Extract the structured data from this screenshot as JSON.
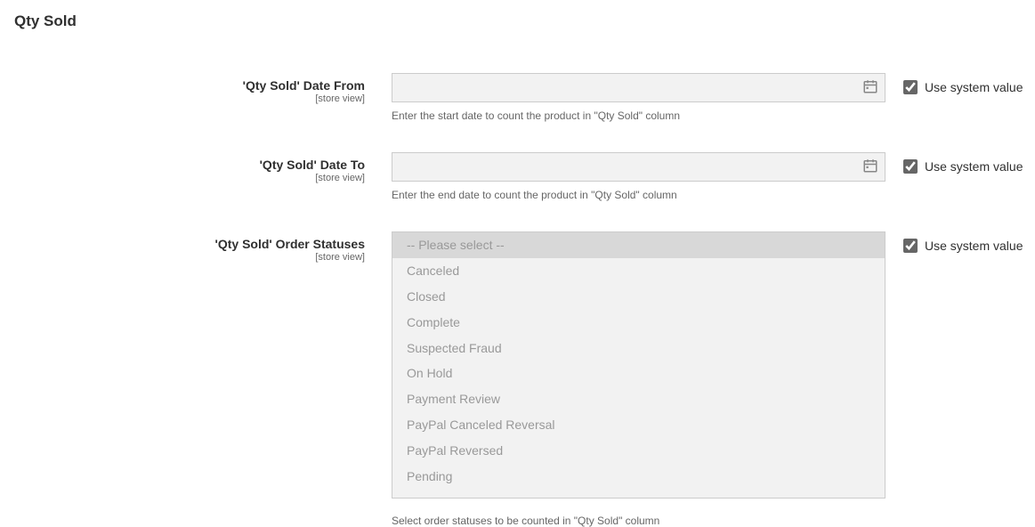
{
  "section": {
    "title": "Qty Sold"
  },
  "fields": {
    "date_from": {
      "label": "'Qty Sold' Date From",
      "scope": "[store view]",
      "value": "",
      "help": "Enter the start date to count the product in \"Qty Sold\" column",
      "use_system_checked": true,
      "use_system_label": "Use system value"
    },
    "date_to": {
      "label": "'Qty Sold' Date To",
      "scope": "[store view]",
      "value": "",
      "help": "Enter the end date to count the product in \"Qty Sold\" column",
      "use_system_checked": true,
      "use_system_label": "Use system value"
    },
    "order_statuses": {
      "label": "'Qty Sold' Order Statuses",
      "scope": "[store view]",
      "options": [
        "-- Please select --",
        "Canceled",
        "Closed",
        "Complete",
        "Suspected Fraud",
        "On Hold",
        "Payment Review",
        "PayPal Canceled Reversal",
        "PayPal Reversed",
        "Pending"
      ],
      "selected_index": 0,
      "help": "Select order statuses to be counted in \"Qty Sold\" column",
      "use_system_checked": true,
      "use_system_label": "Use system value"
    }
  }
}
